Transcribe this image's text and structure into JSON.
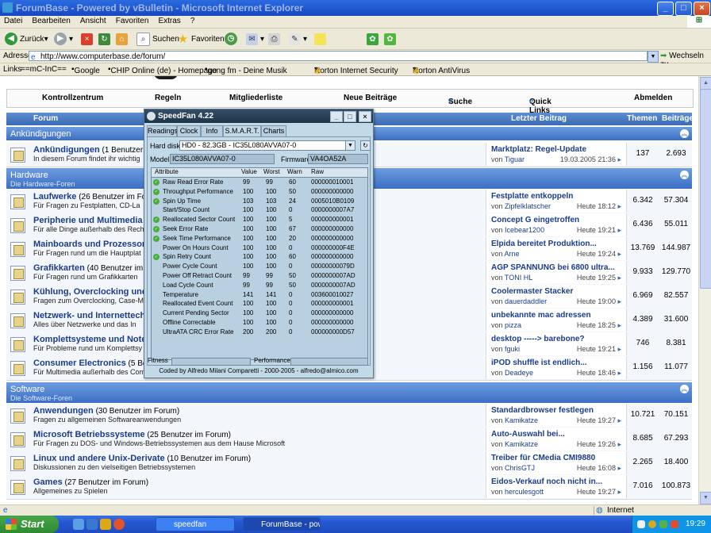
{
  "window": {
    "title": "ForumBase - Powered by vBulletin - Microsoft Internet Explorer"
  },
  "menu": [
    "Datei",
    "Bearbeiten",
    "Ansicht",
    "Favoriten",
    "Extras",
    "?"
  ],
  "toolbar": {
    "back": "Zurück",
    "search": "Suchen",
    "favorites": "Favoriten"
  },
  "address": {
    "label": "Adresse",
    "url": "http://www.computerbase.de/forum/",
    "go": "Wechseln zu"
  },
  "links": {
    "label": "Links",
    "items": [
      "==mC-InC==",
      "Google",
      "CHIP Online (de) - Homepage",
      "gong fm - Deine Musik",
      "Norton Internet Security",
      "Norton AntiVirus"
    ]
  },
  "forum": {
    "nav": [
      "Kontrollzentrum",
      "Regeln",
      "Mitgliederliste",
      "Neue Beiträge",
      "Suche",
      "Quick Links",
      "Abmelden"
    ],
    "headers": {
      "forum": "Forum",
      "last": "Letzter Beitrag",
      "threads": "Themen",
      "posts": "Beiträge"
    },
    "sections": [
      {
        "name": "Ankündigungen",
        "desc": ""
      },
      {
        "name": "Hardware",
        "desc": "Die Hardware-Foren"
      },
      {
        "name": "Software",
        "desc": "Die Software-Foren"
      }
    ],
    "rows": [
      {
        "name": "Ankündigungen",
        "users": "(1 Benutzer im F",
        "desc": "In diesem Forum findet ihr wichtig",
        "title": "Marktplatz: Regel-Update",
        "by": "von",
        "user": "Tiguar",
        "date": "19.03.2005",
        "time": "21:36",
        "threads": "137",
        "posts": "2.693"
      },
      {
        "name": "Laufwerke",
        "users": "(26 Benutzer im Fo",
        "desc": "Für Fragen zu Festplatten, CD-La",
        "title": "Festplatte entkoppeln",
        "by": "von",
        "user": "Zipfelklatscher",
        "date": "Heute",
        "time": "18:12",
        "threads": "6.342",
        "posts": "57.304"
      },
      {
        "name": "Peripherie und Multimedia",
        "users": "(2",
        "desc": "Für alle Dinge außerhalb des Rech",
        "title": "Concept G eingetroffen",
        "by": "von",
        "user": "Icebear1200",
        "date": "Heute",
        "time": "19:21",
        "threads": "6.436",
        "posts": "55.011"
      },
      {
        "name": "Mainboards und Prozessoren",
        "users": "",
        "desc": "Für Fragen rund um die Hauptplat",
        "title": "Elpida bereitet Produktion...",
        "by": "von",
        "user": "Arne",
        "date": "Heute",
        "time": "19:24",
        "threads": "13.769",
        "posts": "144.987"
      },
      {
        "name": "Grafikkarten",
        "users": "(40 Benutzer im Fo",
        "desc": "Für Fragen rund um Grafikkarten",
        "title": "AGP SPANNUNG bei 6800 ultra...",
        "by": "von",
        "user": "TONI HL",
        "date": "Heute",
        "time": "19:25",
        "threads": "9.933",
        "posts": "129.770"
      },
      {
        "name": "Kühlung, Overclocking und Ge",
        "users": "",
        "desc": "Fragen zum Overclocking, Case-M",
        "title": "Coolermaster Stacker",
        "by": "von",
        "user": "dauerdaddler",
        "date": "Heute",
        "time": "19:00",
        "threads": "6.969",
        "posts": "82.557"
      },
      {
        "name": "Netzwerk- und Internettechni",
        "users": "",
        "desc": "Alles über Netzwerke und das In",
        "title": "unbekannte mac adressen",
        "by": "von",
        "user": "pizza",
        "date": "Heute",
        "time": "18:25",
        "threads": "4.389",
        "posts": "31.600"
      },
      {
        "name": "Komplettsysteme und Notebo",
        "users": "",
        "desc": "Für Probleme rund um Komplettsy",
        "title": "desktop -----> barebone?",
        "by": "von",
        "user": "fguki",
        "date": "Heute",
        "time": "19:21",
        "threads": "746",
        "posts": "8.381"
      },
      {
        "name": "Consumer Electronics",
        "users": "(5 Benut",
        "desc": "Für Multimedia außerhalb des Com",
        "title": "iPOD shuffle ist endlich...",
        "by": "von",
        "user": "Deadeye",
        "date": "Heute",
        "time": "18:46",
        "threads": "1.156",
        "posts": "11.077"
      },
      {
        "name": "Anwendungen",
        "users": "(30 Benutzer im Forum)",
        "desc": "Fragen zu allgemeinen Softwareanwendungen",
        "title": "Standardbrowser festlegen",
        "by": "von",
        "user": "Kamikatze",
        "date": "Heute",
        "time": "19:27",
        "threads": "10.721",
        "posts": "70.151"
      },
      {
        "name": "Microsoft Betriebssysteme",
        "users": "(25 Benutzer im Forum)",
        "desc": "Für Fragen zu DOS- und Windows-Betriebssystemen aus dem Hause Microsoft",
        "title": "Auto-Auswahl bei...",
        "by": "von",
        "user": "Kamikatze",
        "date": "Heute",
        "time": "19:26",
        "threads": "8.685",
        "posts": "67.293"
      },
      {
        "name": "Linux und andere Unix-Derivate",
        "users": "(10 Benutzer im Forum)",
        "desc": "Diskussionen zu den vielseitigen Betriebssystemen",
        "title": "Treiber für CMedia CMI9880",
        "by": "von",
        "user": "ChrisGTJ",
        "date": "Heute",
        "time": "16:08",
        "threads": "2.265",
        "posts": "18.400"
      },
      {
        "name": "Games",
        "users": "(27 Benutzer im Forum)",
        "desc": "Allgemeines zu Spielen",
        "title": "Eidos-Verkauf noch nicht in...",
        "by": "von",
        "user": "herculesgott",
        "date": "Heute",
        "time": "19:27",
        "threads": "7.016",
        "posts": "100.873"
      }
    ]
  },
  "speedfan": {
    "title": "SpeedFan 4.22",
    "tabs": [
      "Readings",
      "Clock",
      "Info",
      "S.M.A.R.T.",
      "Charts"
    ],
    "harddisk_label": "Hard disk",
    "harddisk_value": "HD0 - 82.3GB - IC35L080AVVA07-0",
    "model_label": "Model",
    "model_value": "IC35L080AVVA07-0",
    "firmware_label": "Firmware",
    "firmware_value": "VA4OA52A",
    "columns": [
      "Attribute",
      "Value",
      "Worst",
      "Warn",
      "Raw"
    ],
    "attributes": [
      {
        "name": "Raw Read Error Rate",
        "value": "99",
        "worst": "99",
        "warn": "60",
        "raw": "000000010001",
        "ok": true
      },
      {
        "name": "Throughput Performance",
        "value": "100",
        "worst": "100",
        "warn": "50",
        "raw": "000000000000",
        "ok": true
      },
      {
        "name": "Spin Up Time",
        "value": "103",
        "worst": "103",
        "warn": "24",
        "raw": "0005010B0109",
        "ok": true
      },
      {
        "name": "Start/Stop Count",
        "value": "100",
        "worst": "100",
        "warn": "0",
        "raw": "0000000007A7",
        "ok": false
      },
      {
        "name": "Reallocated Sector Count",
        "value": "100",
        "worst": "100",
        "warn": "5",
        "raw": "000000000001",
        "ok": true
      },
      {
        "name": "Seek Error Rate",
        "value": "100",
        "worst": "100",
        "warn": "67",
        "raw": "000000000000",
        "ok": true
      },
      {
        "name": "Seek Time Performance",
        "value": "100",
        "worst": "100",
        "warn": "20",
        "raw": "000000000000",
        "ok": true
      },
      {
        "name": "Power On Hours Count",
        "value": "100",
        "worst": "100",
        "warn": "0",
        "raw": "000000000F4E",
        "ok": false
      },
      {
        "name": "Spin Retry Count",
        "value": "100",
        "worst": "100",
        "warn": "60",
        "raw": "000000000000",
        "ok": true
      },
      {
        "name": "Power Cycle Count",
        "value": "100",
        "worst": "100",
        "warn": "0",
        "raw": "00000000079D",
        "ok": false
      },
      {
        "name": "Power Off Retract Count",
        "value": "99",
        "worst": "99",
        "warn": "50",
        "raw": "0000000007AD",
        "ok": false
      },
      {
        "name": "Load Cycle Count",
        "value": "99",
        "worst": "99",
        "warn": "50",
        "raw": "0000000007AD",
        "ok": false
      },
      {
        "name": "Temperature",
        "value": "141",
        "worst": "141",
        "warn": "0",
        "raw": "003600010027",
        "ok": false
      },
      {
        "name": "Reallocated Event Count",
        "value": "100",
        "worst": "100",
        "warn": "0",
        "raw": "000000000001",
        "ok": false
      },
      {
        "name": "Current Pending Sector",
        "value": "100",
        "worst": "100",
        "warn": "0",
        "raw": "000000000000",
        "ok": false
      },
      {
        "name": "Offline Correctable",
        "value": "100",
        "worst": "100",
        "warn": "0",
        "raw": "000000000000",
        "ok": false
      },
      {
        "name": "UltraATA CRC Error Rate",
        "value": "200",
        "worst": "200",
        "warn": "0",
        "raw": "000000000D57",
        "ok": false
      }
    ],
    "fitness_label": "Fitness",
    "performance_label": "Performance",
    "footer": "Coded by Alfredo Milani Comparetti - 2000-2005 - alfredo@almico.com"
  },
  "status": {
    "zone": "Internet"
  },
  "taskbar": {
    "start": "Start",
    "tasks": [
      "speedfan",
      "ForumBase - pow..."
    ],
    "clock": "19:29"
  }
}
